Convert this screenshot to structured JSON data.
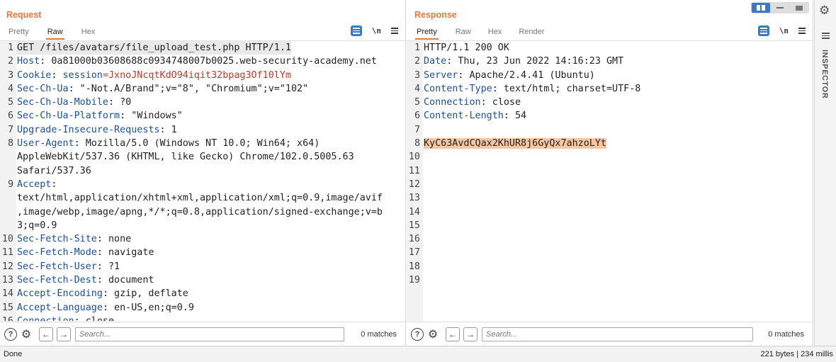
{
  "request": {
    "title": "Request",
    "tabs": [
      "Pretty",
      "Raw",
      "Hex"
    ],
    "active_tab": "Raw",
    "search_placeholder": "Search...",
    "matches": "0 matches",
    "lines": [
      {
        "n": "1",
        "segments": [
          {
            "t": "GET /files/avatars/file_upload_test.php HTTP/1.1",
            "c": "plain"
          }
        ]
      },
      {
        "n": "2",
        "segments": [
          {
            "t": "Host",
            "c": "hname"
          },
          {
            "t": ": 0a81000b03608688c0934748007b0025.web-security-academy.net",
            "c": "plain"
          }
        ]
      },
      {
        "n": "3",
        "segments": [
          {
            "t": "Cookie",
            "c": "hname"
          },
          {
            "t": ": ",
            "c": "plain"
          },
          {
            "t": "session",
            "c": "cookie-key"
          },
          {
            "t": "=JxnoJNcqtKdO94iqit32bpag3Of10lYm",
            "c": "cookie-val"
          }
        ]
      },
      {
        "n": "4",
        "segments": [
          {
            "t": "Sec-Ch-Ua",
            "c": "hname"
          },
          {
            "t": ": \"-Not.A/Brand\";v=\"8\", \"Chromium\";v=\"102\"",
            "c": "plain"
          }
        ]
      },
      {
        "n": "5",
        "segments": [
          {
            "t": "Sec-Ch-Ua-Mobile",
            "c": "hname"
          },
          {
            "t": ": ?0",
            "c": "plain"
          }
        ]
      },
      {
        "n": "6",
        "segments": [
          {
            "t": "Sec-Ch-Ua-Platform",
            "c": "hname"
          },
          {
            "t": ": \"Windows\"",
            "c": "plain"
          }
        ]
      },
      {
        "n": "7",
        "segments": [
          {
            "t": "Upgrade-Insecure-Requests",
            "c": "hname"
          },
          {
            "t": ": 1",
            "c": "plain"
          }
        ]
      },
      {
        "n": "8",
        "segments": [
          {
            "t": "User-Agent",
            "c": "hname"
          },
          {
            "t": ": Mozilla/5.0 (Windows NT 10.0; Win64; x64)",
            "c": "plain"
          }
        ]
      },
      {
        "n": "",
        "segments": [
          {
            "t": "AppleWebKit/537.36 (KHTML, like Gecko) Chrome/102.0.5005.63",
            "c": "plain"
          }
        ]
      },
      {
        "n": "",
        "segments": [
          {
            "t": "Safari/537.36",
            "c": "plain"
          }
        ]
      },
      {
        "n": "9",
        "segments": [
          {
            "t": "Accept",
            "c": "hname"
          },
          {
            "t": ":",
            "c": "plain"
          }
        ]
      },
      {
        "n": "",
        "segments": [
          {
            "t": "text/html,application/xhtml+xml,application/xml;q=0.9,image/avif",
            "c": "plain"
          }
        ]
      },
      {
        "n": "",
        "segments": [
          {
            "t": ",image/webp,image/apng,*/*;q=0.8,application/signed-exchange;v=b",
            "c": "plain"
          }
        ]
      },
      {
        "n": "",
        "segments": [
          {
            "t": "3;q=0.9",
            "c": "plain"
          }
        ]
      },
      {
        "n": "10",
        "segments": [
          {
            "t": "Sec-Fetch-Site",
            "c": "hname"
          },
          {
            "t": ": none",
            "c": "plain"
          }
        ]
      },
      {
        "n": "11",
        "segments": [
          {
            "t": "Sec-Fetch-Mode",
            "c": "hname"
          },
          {
            "t": ": navigate",
            "c": "plain"
          }
        ]
      },
      {
        "n": "12",
        "segments": [
          {
            "t": "Sec-Fetch-User",
            "c": "hname"
          },
          {
            "t": ": ?1",
            "c": "plain"
          }
        ]
      },
      {
        "n": "13",
        "segments": [
          {
            "t": "Sec-Fetch-Dest",
            "c": "hname"
          },
          {
            "t": ": document",
            "c": "plain"
          }
        ]
      },
      {
        "n": "14",
        "segments": [
          {
            "t": "Accept-Encoding",
            "c": "hname"
          },
          {
            "t": ": gzip, deflate",
            "c": "plain"
          }
        ]
      },
      {
        "n": "15",
        "segments": [
          {
            "t": "Accept-Language",
            "c": "hname"
          },
          {
            "t": ": en-US,en;q=0.9",
            "c": "plain"
          }
        ]
      },
      {
        "n": "16",
        "segments": [
          {
            "t": "Connection",
            "c": "hname"
          },
          {
            "t": ": close",
            "c": "plain"
          }
        ]
      }
    ]
  },
  "response": {
    "title": "Response",
    "tabs": [
      "Pretty",
      "Raw",
      "Hex",
      "Render"
    ],
    "active_tab": "Pretty",
    "search_placeholder": "Search...",
    "matches": "0 matches",
    "lines": [
      {
        "n": "1",
        "segments": [
          {
            "t": "HTTP/1.1 200 OK",
            "c": "plain"
          }
        ]
      },
      {
        "n": "2",
        "segments": [
          {
            "t": "Date",
            "c": "hname"
          },
          {
            "t": ": Thu, 23 Jun 2022 14:16:23 GMT",
            "c": "plain"
          }
        ]
      },
      {
        "n": "3",
        "segments": [
          {
            "t": "Server",
            "c": "hname"
          },
          {
            "t": ": Apache/2.4.41 (Ubuntu)",
            "c": "plain"
          }
        ]
      },
      {
        "n": "4",
        "segments": [
          {
            "t": "Content-Type",
            "c": "hname"
          },
          {
            "t": ": text/html; charset=UTF-8",
            "c": "plain"
          }
        ]
      },
      {
        "n": "5",
        "segments": [
          {
            "t": "Connection",
            "c": "hname"
          },
          {
            "t": ": close",
            "c": "plain"
          }
        ]
      },
      {
        "n": "6",
        "segments": [
          {
            "t": "Content-Length",
            "c": "hname"
          },
          {
            "t": ": 54",
            "c": "plain"
          }
        ]
      },
      {
        "n": "7",
        "segments": []
      },
      {
        "n": "8",
        "segments": [
          {
            "t": "KyC63AvdCQax2KhUR8j6GyQx7ahzoLYt",
            "c": "hl"
          }
        ]
      },
      {
        "n": "10",
        "segments": []
      },
      {
        "n": "11",
        "segments": []
      },
      {
        "n": "12",
        "segments": []
      },
      {
        "n": "13",
        "segments": []
      },
      {
        "n": "14",
        "segments": []
      },
      {
        "n": "15",
        "segments": []
      },
      {
        "n": "16",
        "segments": []
      },
      {
        "n": "17",
        "segments": []
      },
      {
        "n": "18",
        "segments": []
      },
      {
        "n": "19",
        "segments": []
      }
    ]
  },
  "inspector": {
    "label": "INSPECTOR"
  },
  "status": {
    "left": "Done",
    "right": "221 bytes | 234 millis"
  },
  "colors": {
    "accent": "#e8773a",
    "header_name": "#1a4fa3",
    "cookie_value": "#c0392b",
    "highlight": "#f8c6a0",
    "toolbar_blue": "#3a78c9"
  },
  "icons": {
    "wrap": "text-wrap-icon",
    "newline": "newline-icon",
    "menu": "hamburger-icon",
    "help": "help-icon",
    "settings": "gear-icon",
    "prev": "arrow-left-icon",
    "next": "arrow-right-icon",
    "newline_label": "\\n"
  }
}
